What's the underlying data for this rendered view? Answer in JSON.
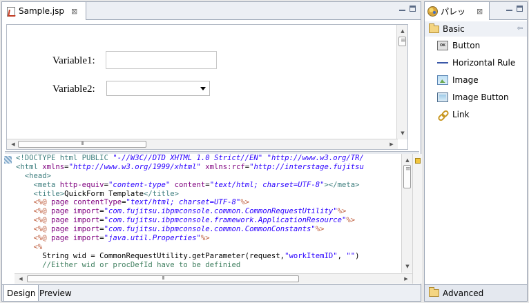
{
  "editor": {
    "tab_label": "Sample.jsp",
    "tab_close": "⊠",
    "design": {
      "variable1_label": "Variable1:",
      "variable1_value": "",
      "variable2_label": "Variable2:",
      "variable2_value": ""
    },
    "source_lines": [
      [
        [
          "c-doc",
          "<!DOCTYPE html PUBLIC "
        ],
        [
          "c-str",
          "\"-//W3C//DTD XHTML 1.0 Strict//EN\""
        ],
        [
          "c-doc",
          " "
        ],
        [
          "c-str",
          "\"http://www.w3.org/TR/"
        ]
      ],
      [
        [
          "c-tag",
          "<html "
        ],
        [
          "c-attr",
          "xmlns"
        ],
        [
          "c-text",
          "="
        ],
        [
          "c-str",
          "\"http://www.w3.org/1999/xhtml\""
        ],
        [
          "c-text",
          " "
        ],
        [
          "c-attr",
          "xmlns:rcf"
        ],
        [
          "c-text",
          "="
        ],
        [
          "c-str",
          "\"http://interstage.fujitsu"
        ]
      ],
      [
        [
          "c-tag",
          "  <head>"
        ]
      ],
      [
        [
          "c-tag",
          "    <meta "
        ],
        [
          "c-attr",
          "http-equiv"
        ],
        [
          "c-text",
          "="
        ],
        [
          "c-str",
          "\"content-type\""
        ],
        [
          "c-text",
          " "
        ],
        [
          "c-attr",
          "content"
        ],
        [
          "c-text",
          "="
        ],
        [
          "c-str",
          "\"text/html; charset=UTF-8\""
        ],
        [
          "c-tag",
          "></meta>"
        ]
      ],
      [
        [
          "c-tag",
          "    <title>"
        ],
        [
          "c-text",
          "QuickForm Template"
        ],
        [
          "c-tag",
          "</title>"
        ]
      ],
      [
        [
          "c-dir",
          "    <%@ "
        ],
        [
          "c-attr",
          "page "
        ],
        [
          "c-attr",
          "contentType"
        ],
        [
          "c-text",
          "="
        ],
        [
          "c-str",
          "\"text/html; charset=UTF-8\""
        ],
        [
          "c-dir",
          "%>"
        ]
      ],
      [
        [
          "c-dir",
          "    <%@ "
        ],
        [
          "c-attr",
          "page "
        ],
        [
          "c-attr",
          "import"
        ],
        [
          "c-text",
          "="
        ],
        [
          "c-str",
          "\"com.fujitsu.ibpmconsole.common.CommonRequestUtility\""
        ],
        [
          "c-dir",
          "%>"
        ]
      ],
      [
        [
          "c-dir",
          "    <%@ "
        ],
        [
          "c-attr",
          "page "
        ],
        [
          "c-attr",
          "import"
        ],
        [
          "c-text",
          "="
        ],
        [
          "c-str",
          "\"com.fujitsu.ibpmconsole.framework.ApplicationResource\""
        ],
        [
          "c-dir",
          "%>"
        ]
      ],
      [
        [
          "c-dir",
          "    <%@ "
        ],
        [
          "c-attr",
          "page "
        ],
        [
          "c-attr",
          "import"
        ],
        [
          "c-text",
          "="
        ],
        [
          "c-str",
          "\"com.fujitsu.ibpmconsole.common.CommonConstants\""
        ],
        [
          "c-dir",
          "%>"
        ]
      ],
      [
        [
          "c-dir",
          "    <%@ "
        ],
        [
          "c-attr",
          "page "
        ],
        [
          "c-attr",
          "import"
        ],
        [
          "c-text",
          "="
        ],
        [
          "c-str",
          "\"java.util.Properties\""
        ],
        [
          "c-dir",
          "%>"
        ]
      ],
      [
        [
          "c-dir",
          "    <%"
        ]
      ],
      [
        [
          "c-text",
          "      String wid = CommonRequestUtility.getParameter(request,"
        ],
        [
          "c-jstr",
          "\"workItemID\""
        ],
        [
          "c-text",
          ", "
        ],
        [
          "c-jstr",
          "\"\""
        ],
        [
          "c-text",
          ")"
        ]
      ],
      [
        [
          "c-cmt",
          "      //Either wid or procDefId have to be definied"
        ]
      ]
    ],
    "bottom_tabs": [
      "Design",
      "Preview"
    ]
  },
  "palette": {
    "tab_label": "パレッ",
    "tab_close": "⊠",
    "basic_drawer": "Basic",
    "items": [
      "Button",
      "Horizontal Rule",
      "Image",
      "Image Button",
      "Link"
    ],
    "button_icon_text": "OK",
    "advanced_drawer": "Advanced"
  }
}
